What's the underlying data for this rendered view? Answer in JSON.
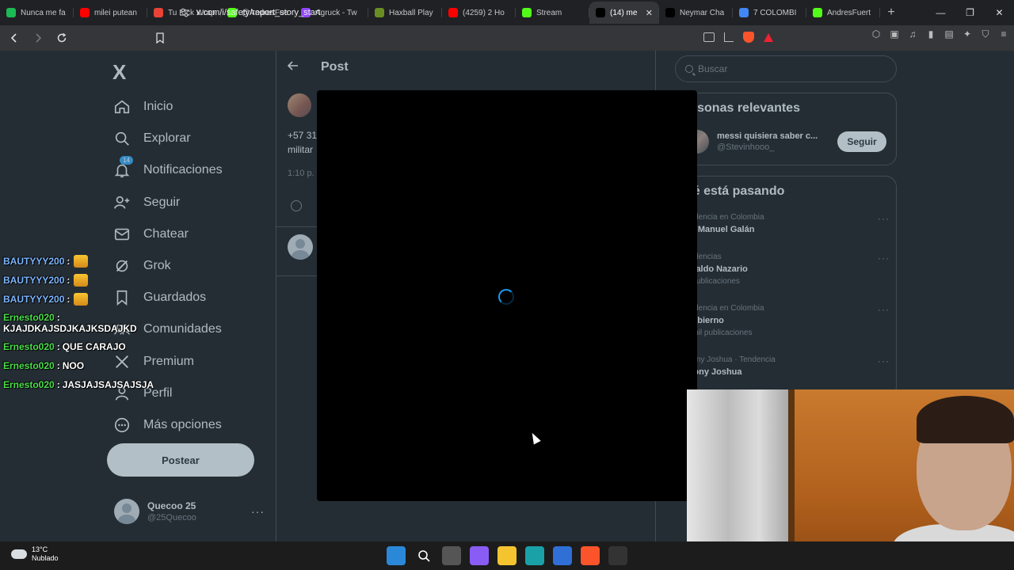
{
  "browser": {
    "tabs": [
      {
        "title": "Nunca me fa",
        "color": "#1db954"
      },
      {
        "title": "milei putean",
        "color": "#ff0000"
      },
      {
        "title": "Tu Kick Wrap",
        "color": "#ea4335"
      },
      {
        "title": "@AndresFue",
        "color": "#53fc18"
      },
      {
        "title": "Agruck - Tw",
        "color": "#9146ff"
      },
      {
        "title": "Haxball Play",
        "color": "#6b8e23"
      },
      {
        "title": "(4259) 2 Ho",
        "color": "#ff0000"
      },
      {
        "title": "Stream",
        "color": "#53fc18"
      },
      {
        "title": "(14) me",
        "color": "#000000",
        "active": true
      },
      {
        "title": "Neymar Cha",
        "color": "#000000"
      },
      {
        "title": "7 COLOMBI",
        "color": "#4285f4"
      },
      {
        "title": "AndresFuert",
        "color": "#53fc18"
      }
    ],
    "new_tab": "+",
    "tab_close": "✕",
    "url": "x.com/i/safety/report_story_start",
    "win": {
      "minimize": "—",
      "maximize": "❐",
      "close": "✕"
    }
  },
  "sidebar": {
    "logo": "X",
    "items": [
      {
        "label": "Inicio",
        "icon": "home-icon"
      },
      {
        "label": "Explorar",
        "icon": "search-icon"
      },
      {
        "label": "Notificaciones",
        "icon": "bell-icon",
        "badge": "14"
      },
      {
        "label": "Seguir",
        "icon": "add-person-icon"
      },
      {
        "label": "Chatear",
        "icon": "mail-icon"
      },
      {
        "label": "Grok",
        "icon": "grok-icon"
      },
      {
        "label": "Guardados",
        "icon": "bookmark-icon"
      },
      {
        "label": "Comunidades",
        "icon": "communities-icon"
      },
      {
        "label": "Premium",
        "icon": "x-premium-icon"
      },
      {
        "label": "Perfil",
        "icon": "person-icon"
      },
      {
        "label": "Más opciones",
        "icon": "more-circle-icon"
      }
    ],
    "post_button": "Postear",
    "account": {
      "name": "Quecoo 25",
      "handle": "@25Quecoo",
      "more": "···"
    }
  },
  "main": {
    "title": "Post",
    "tweet_text_line1": "+57 31",
    "tweet_text_line2": "militar",
    "tweet_time": "1:10 p."
  },
  "right": {
    "search_placeholder": "Buscar",
    "relevant_title": "ersonas relevantes",
    "person": {
      "name": "messi quisiera saber c...",
      "handle": "@Stevinhooo_",
      "follow": "Seguir"
    },
    "trends_title": "ué está pasando",
    "trends": [
      {
        "context": "endencia en Colombia",
        "name": "an Manuel Galán",
        "count": ""
      },
      {
        "context": "endencias",
        "name": "onaldo Nazario",
        "count": "6 publicaciones"
      },
      {
        "context": "endencia en Colombia",
        "name": "Gobierno",
        "count": "3 mil publicaciones"
      },
      {
        "context": "thony Joshua · Tendencia",
        "name": "thony Joshua",
        "count": ""
      }
    ],
    "more": "···"
  },
  "chat": [
    {
      "user": "BAUTYYY200",
      "msg": "",
      "color": "#7cb6ff",
      "emote": true
    },
    {
      "user": "BAUTYYY200",
      "msg": "",
      "color": "#7cb6ff",
      "emote": true
    },
    {
      "user": "BAUTYYY200",
      "msg": "",
      "color": "#7cb6ff",
      "emote": true
    },
    {
      "user": "Ernesto020",
      "msg": "KJAJDKAJSDJKAJKSDAJKD",
      "color": "#4ade4a"
    },
    {
      "user": "Ernesto020",
      "msg": "QUE CARAJO",
      "color": "#4ade4a"
    },
    {
      "user": "Ernesto020",
      "msg": "NOO",
      "color": "#4ade4a"
    },
    {
      "user": "Ernesto020",
      "msg": "JASJAJSAJSAJSJA",
      "color": "#4ade4a"
    }
  ],
  "chat_separator": ":",
  "taskbar": {
    "weather_temp": "13°C",
    "weather_desc": "Nublado",
    "icons": [
      "windows-start-icon",
      "search-icon",
      "task-view-icon",
      "copilot-icon",
      "file-explorer-icon",
      "edge-icon",
      "mail-icon",
      "brave-icon",
      "obs-icon"
    ]
  }
}
